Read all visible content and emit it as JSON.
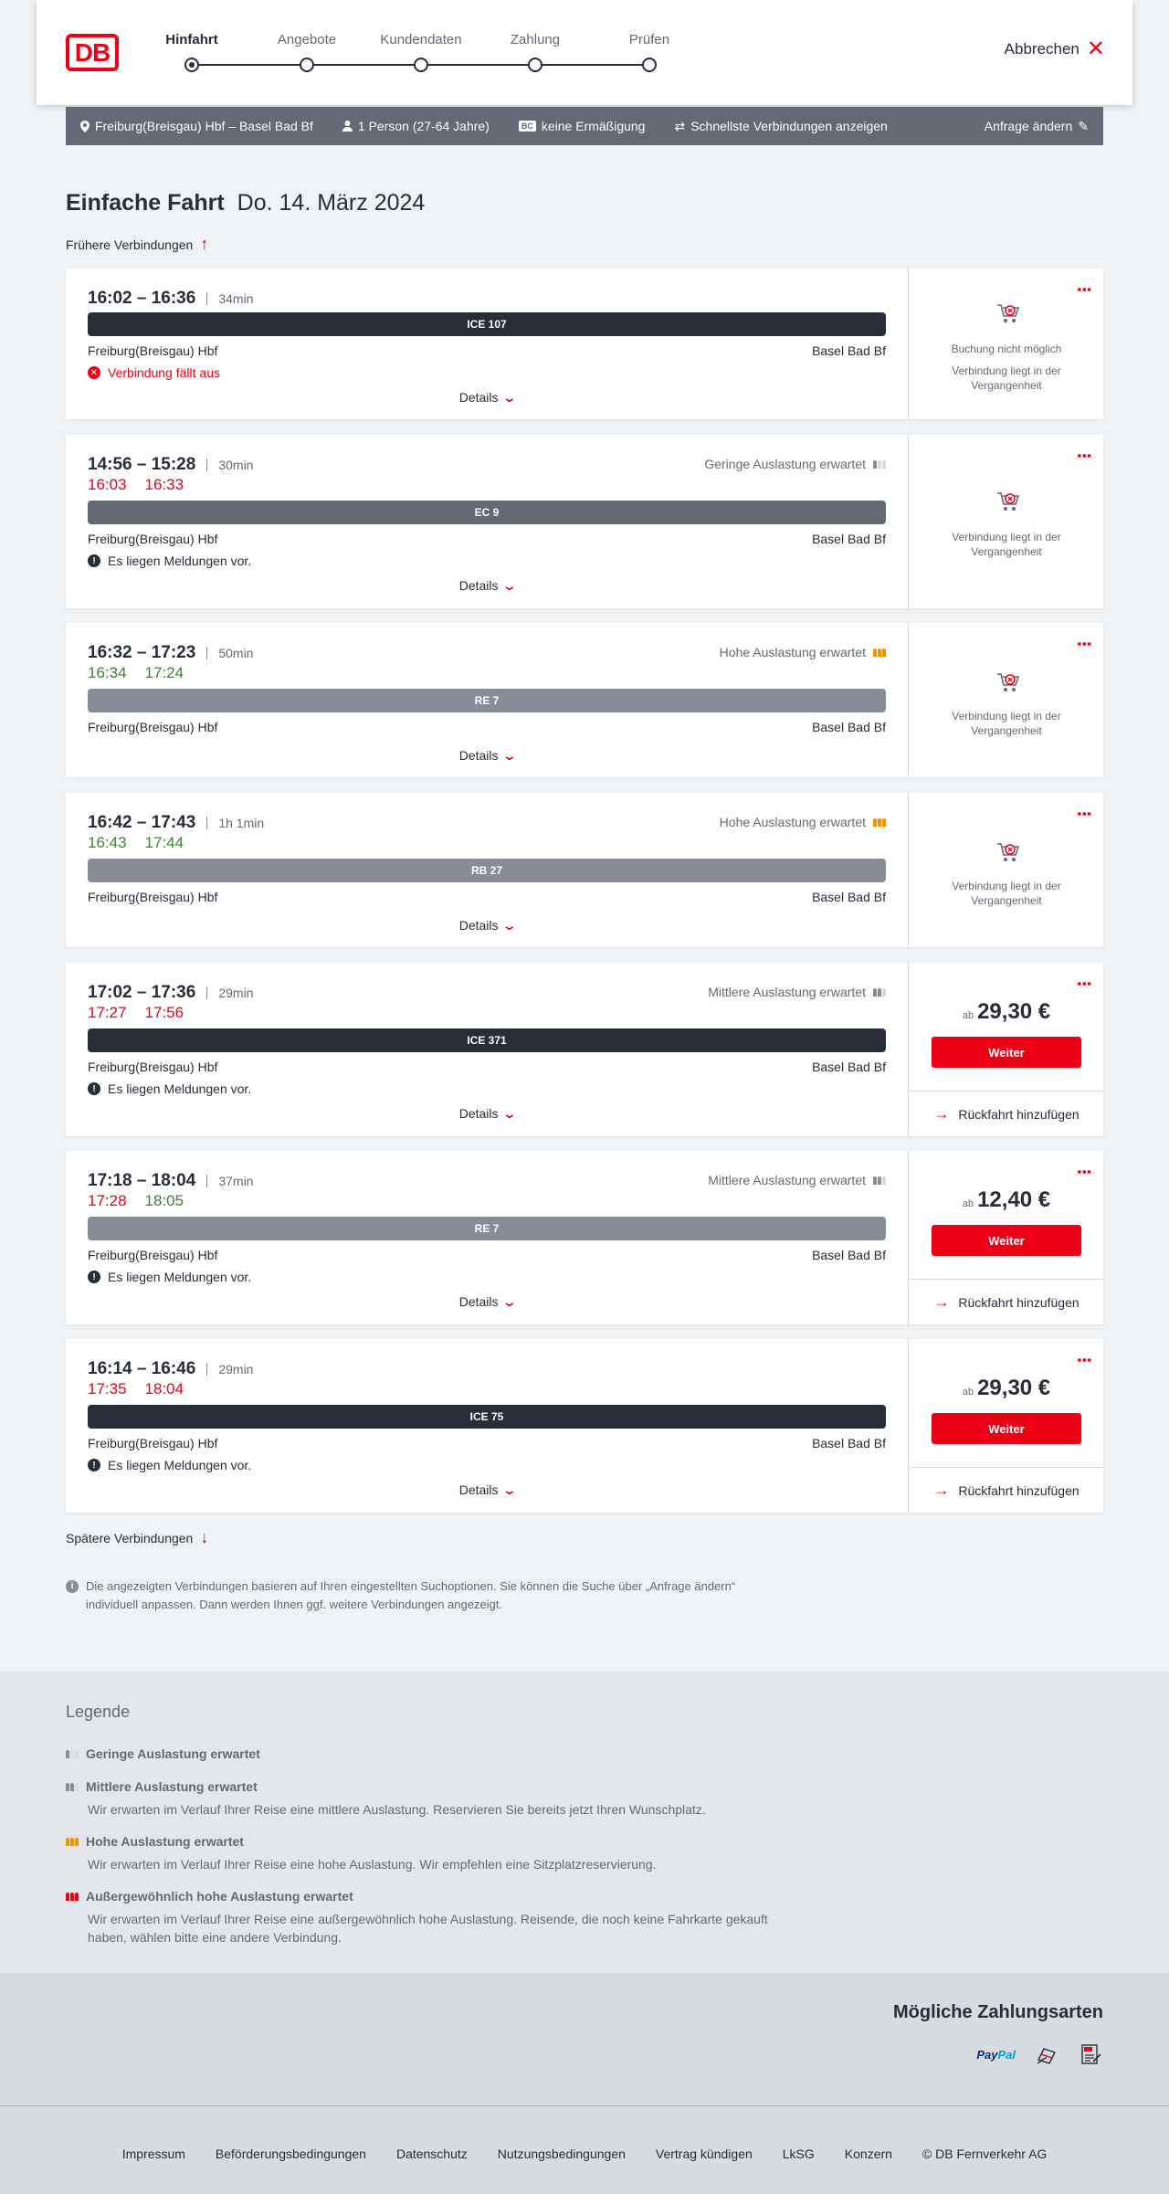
{
  "header": {
    "logo_text": "DB",
    "steps": [
      {
        "label": "Hinfahrt",
        "active": true
      },
      {
        "label": "Angebote",
        "active": false
      },
      {
        "label": "Kundendaten",
        "active": false
      },
      {
        "label": "Zahlung",
        "active": false
      },
      {
        "label": "Prüfen",
        "active": false
      }
    ],
    "cancel_label": "Abbrechen"
  },
  "summary": {
    "route": "Freiburg(Breisgau) Hbf – Basel Bad Bf",
    "persons": "1 Person (27-64 Jahre)",
    "discount_badge": "BC",
    "discount": "keine Ermäßigung",
    "option": "Schnellste Verbindungen anzeigen",
    "edit_label": "Anfrage ändern"
  },
  "title": {
    "trip_type": "Einfache Fahrt",
    "date": "Do. 14. März 2024"
  },
  "earlier_label": "Frühere Verbindungen",
  "later_label": "Spätere Verbindungen",
  "details_label": "Details",
  "connections": [
    {
      "times": "16:02 – 16:36",
      "duration": "34min",
      "train": "ICE 107",
      "from": "Freiburg(Breisgau) Hbf",
      "to": "Basel Bad Bf",
      "message": "Verbindung fällt aus",
      "unavailable_title": "Buchung nicht möglich",
      "unavailable": "Verbindung liegt in der Vergangenheit"
    },
    {
      "times": "14:56 – 15:28",
      "duration": "30min",
      "rt_dep": "16:03",
      "rt_arr": "16:33",
      "occupancy": "Geringe Auslastung erwartet",
      "train": "EC 9",
      "from": "Freiburg(Breisgau) Hbf",
      "to": "Basel Bad Bf",
      "message": "Es liegen Meldungen vor.",
      "unavailable": "Verbindung liegt in der Vergangenheit"
    },
    {
      "times": "16:32 – 17:23",
      "duration": "50min",
      "rt_dep": "16:34",
      "rt_arr": "17:24",
      "occupancy": "Hohe Auslastung erwartet",
      "train": "RE 7",
      "from": "Freiburg(Breisgau) Hbf",
      "to": "Basel Bad Bf",
      "unavailable": "Verbindung liegt in der Vergangenheit"
    },
    {
      "times": "16:42 – 17:43",
      "duration": "1h 1min",
      "rt_dep": "16:43",
      "rt_arr": "17:44",
      "occupancy": "Hohe Auslastung erwartet",
      "train": "RB 27",
      "from": "Freiburg(Breisgau) Hbf",
      "to": "Basel Bad Bf",
      "unavailable": "Verbindung liegt in der Vergangenheit"
    },
    {
      "times": "17:02 – 17:36",
      "duration": "29min",
      "rt_dep": "17:27",
      "rt_arr": "17:56",
      "occupancy": "Mittlere Auslastung erwartet",
      "train": "ICE 371",
      "from": "Freiburg(Breisgau) Hbf",
      "to": "Basel Bad Bf",
      "message": "Es liegen Meldungen vor.",
      "price_prefix": "ab",
      "price": "29,30 €",
      "button": "Weiter",
      "return_label": "Rückfahrt hinzufügen"
    },
    {
      "times": "17:18 – 18:04",
      "duration": "37min",
      "rt_dep": "17:28",
      "rt_arr": "18:05",
      "occupancy": "Mittlere Auslastung erwartet",
      "train": "RE 7",
      "from": "Freiburg(Breisgau) Hbf",
      "to": "Basel Bad Bf",
      "message": "Es liegen Meldungen vor.",
      "price_prefix": "ab",
      "price": "12,40 €",
      "button": "Weiter",
      "return_label": "Rückfahrt hinzufügen"
    },
    {
      "times": "16:14 – 16:46",
      "duration": "29min",
      "rt_dep": "17:35",
      "rt_arr": "18:04",
      "train": "ICE 75",
      "from": "Freiburg(Breisgau) Hbf",
      "to": "Basel Bad Bf",
      "message": "Es liegen Meldungen vor.",
      "price_prefix": "ab",
      "price": "29,30 €",
      "button": "Weiter",
      "return_label": "Rückfahrt hinzufügen"
    }
  ],
  "info_text": "Die angezeigten Verbindungen basieren auf Ihren eingestellten Suchoptionen. Sie können die Suche über „Anfrage ändern“ individuell anpassen. Dann werden Ihnen ggf. weitere Verbindungen angezeigt.",
  "legend": {
    "title": "Legende",
    "items": [
      {
        "title": "Geringe Auslastung erwartet",
        "desc": ""
      },
      {
        "title": "Mittlere Auslastung erwartet",
        "desc": "Wir erwarten im Verlauf Ihrer Reise eine mittlere Auslastung. Reservieren Sie bereits jetzt Ihren Wunschplatz."
      },
      {
        "title": "Hohe Auslastung erwartet",
        "desc": "Wir erwarten im Verlauf Ihrer Reise eine hohe Auslastung. Wir empfehlen eine Sitzplatzreservierung."
      },
      {
        "title": "Außergewöhnlich hohe Auslastung erwartet",
        "desc": "Wir erwarten im Verlauf Ihrer Reise eine außergewöhnlich hohe Auslastung. Reisende, die noch keine Fahrkarte gekauft haben, wählen bitte eine andere Verbindung."
      }
    ]
  },
  "payment": {
    "title": "Mögliche Zahlungsarten",
    "paypal_a": "Pay",
    "paypal_b": "Pal"
  },
  "footer": [
    "Impressum",
    "Beförderungsbedingungen",
    "Datenschutz",
    "Nutzungsbedingungen",
    "Vertrag kündigen",
    "LkSG",
    "Konzern",
    "© DB Fernverkehr AG"
  ],
  "colors": {
    "accent": "#ec0016",
    "delay": "#ec0016",
    "ontime": "#408335",
    "high_occupancy": "#f39200"
  }
}
